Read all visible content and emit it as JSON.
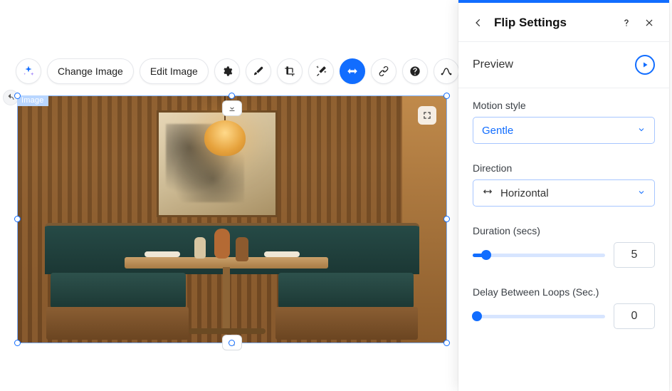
{
  "toolbar": {
    "change_image": "Change Image",
    "edit_image": "Edit Image"
  },
  "selection_label": "Image",
  "panel": {
    "title": "Flip Settings",
    "preview_label": "Preview",
    "motion_style": {
      "label": "Motion style",
      "value": "Gentle"
    },
    "direction": {
      "label": "Direction",
      "value": "Horizontal"
    },
    "duration": {
      "label": "Duration (secs)",
      "value": "5",
      "percent": 10
    },
    "delay": {
      "label": "Delay Between Loops (Sec.)",
      "value": "0",
      "percent": 0
    }
  }
}
